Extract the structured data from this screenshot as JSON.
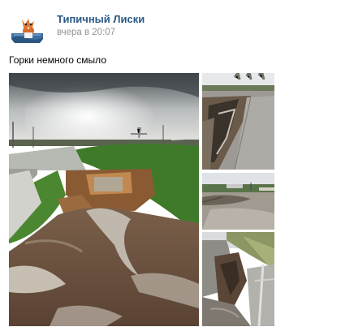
{
  "post": {
    "author_name": "Типичный Лиски",
    "timestamp": "вчера в 20:07",
    "text": "Горки немного смыло"
  },
  "photos": [
    {
      "name": "photo-main-washout"
    },
    {
      "name": "photo-collapsed-edge"
    },
    {
      "name": "photo-flooded-area"
    },
    {
      "name": "photo-damaged-slope"
    }
  ],
  "colors": {
    "author_link": "#2a5885",
    "timestamp": "#939393"
  },
  "icons": {
    "avatar": "fox-logo-icon"
  }
}
